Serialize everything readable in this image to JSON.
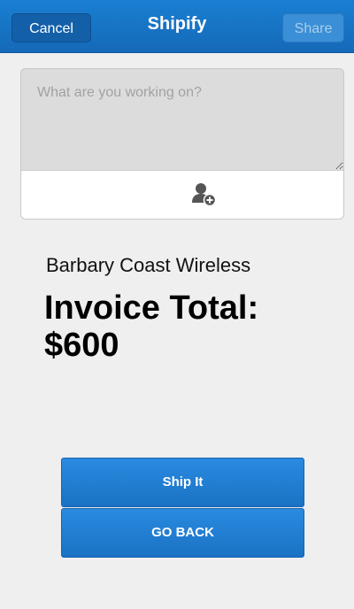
{
  "header": {
    "title": "Shipify",
    "cancel_label": "Cancel",
    "share_label": "Share"
  },
  "compose": {
    "placeholder": "What are you working on?",
    "value": "",
    "toolbar_icon": "add-person-icon"
  },
  "invoice": {
    "company": "Barbary Coast Wireless",
    "total_label": "Invoice Total:",
    "total_amount": "$600"
  },
  "actions": {
    "ship_label": "Ship It",
    "go_back_label": "GO BACK"
  },
  "colors": {
    "header_blue": "#1a7fd2",
    "button_blue": "#2a8be0",
    "background": "#efefef"
  }
}
